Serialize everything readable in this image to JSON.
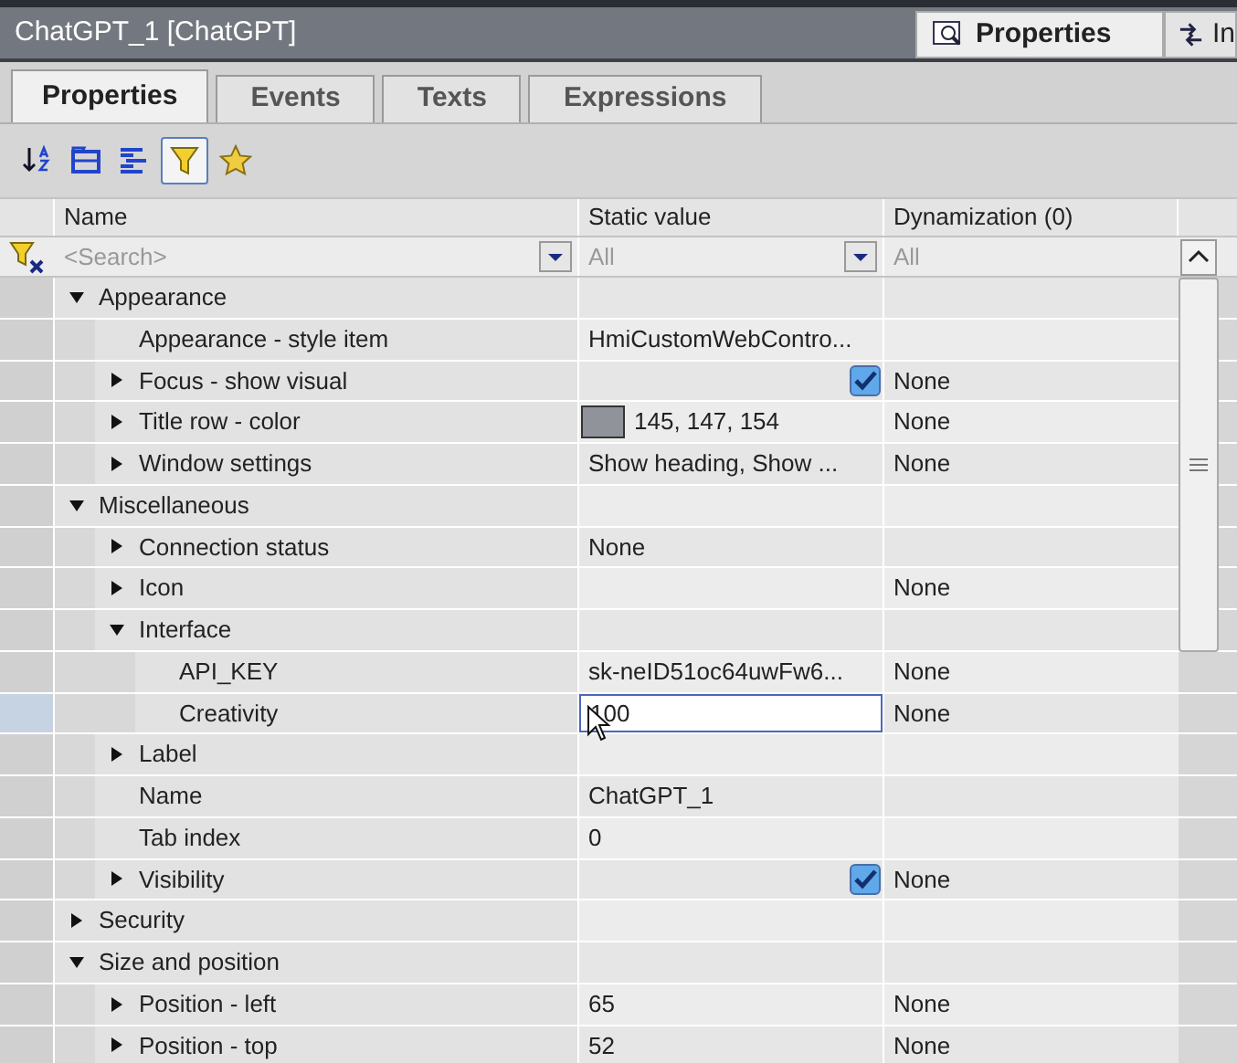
{
  "window": {
    "title": "ChatGPT_1 [ChatGPT]"
  },
  "side_tabs": [
    {
      "label": "Properties",
      "selected": true
    },
    {
      "label": "In",
      "selected": false
    }
  ],
  "tabs": [
    {
      "label": "Properties",
      "selected": true
    },
    {
      "label": "Events",
      "selected": false
    },
    {
      "label": "Texts",
      "selected": false
    },
    {
      "label": "Expressions",
      "selected": false
    }
  ],
  "toolbar": [
    {
      "kind": "sort",
      "selected": false
    },
    {
      "kind": "group",
      "selected": false
    },
    {
      "kind": "list",
      "selected": false
    },
    {
      "kind": "filter",
      "selected": true
    },
    {
      "kind": "favorite",
      "selected": false
    }
  ],
  "columns": [
    "Name",
    "Static value",
    "Dynamization (0)"
  ],
  "filter_row": {
    "name_placeholder": "<Search>",
    "value_placeholder": "All",
    "dynamization_placeholder": "All"
  },
  "rows": [
    {
      "name": "Appearance",
      "expanded": true,
      "children": [
        {
          "name": "Appearance - style item",
          "value": "HmiCustomWebContro..."
        },
        {
          "name": "Focus - show visual",
          "expanded": false,
          "checked": true,
          "dynamization": "None"
        },
        {
          "name": "Title row - color",
          "expanded": false,
          "color": "#91939a",
          "value": "145, 147, 154",
          "dynamization": "None"
        },
        {
          "name": "Window settings",
          "expanded": false,
          "value": "Show heading, Show ...",
          "dynamization": "None"
        }
      ]
    },
    {
      "name": "Miscellaneous",
      "expanded": true,
      "children": [
        {
          "name": "Connection status",
          "expanded": false,
          "value": "None"
        },
        {
          "name": "Icon",
          "expanded": false,
          "dynamization": "None"
        },
        {
          "name": "Interface",
          "expanded": true,
          "children": [
            {
              "name": "API_KEY",
              "value": "sk-neID51oc64uwFw6...",
              "dynamization": "None"
            },
            {
              "name": "Creativity",
              "value": "100",
              "editing": true,
              "selected": true,
              "dynamization": "None"
            }
          ]
        },
        {
          "name": "Label",
          "expanded": false
        },
        {
          "name": "Name",
          "value": "ChatGPT_1"
        },
        {
          "name": "Tab index",
          "value": "0"
        },
        {
          "name": "Visibility",
          "expanded": false,
          "checked": true,
          "dynamization": "None"
        }
      ]
    },
    {
      "name": "Security",
      "expanded": false
    },
    {
      "name": "Size and position",
      "expanded": true,
      "children": [
        {
          "name": "Position - left",
          "expanded": false,
          "value": "65",
          "dynamization": "None"
        },
        {
          "name": "Position - top",
          "expanded": false,
          "value": "52",
          "dynamization": "None"
        }
      ]
    }
  ]
}
